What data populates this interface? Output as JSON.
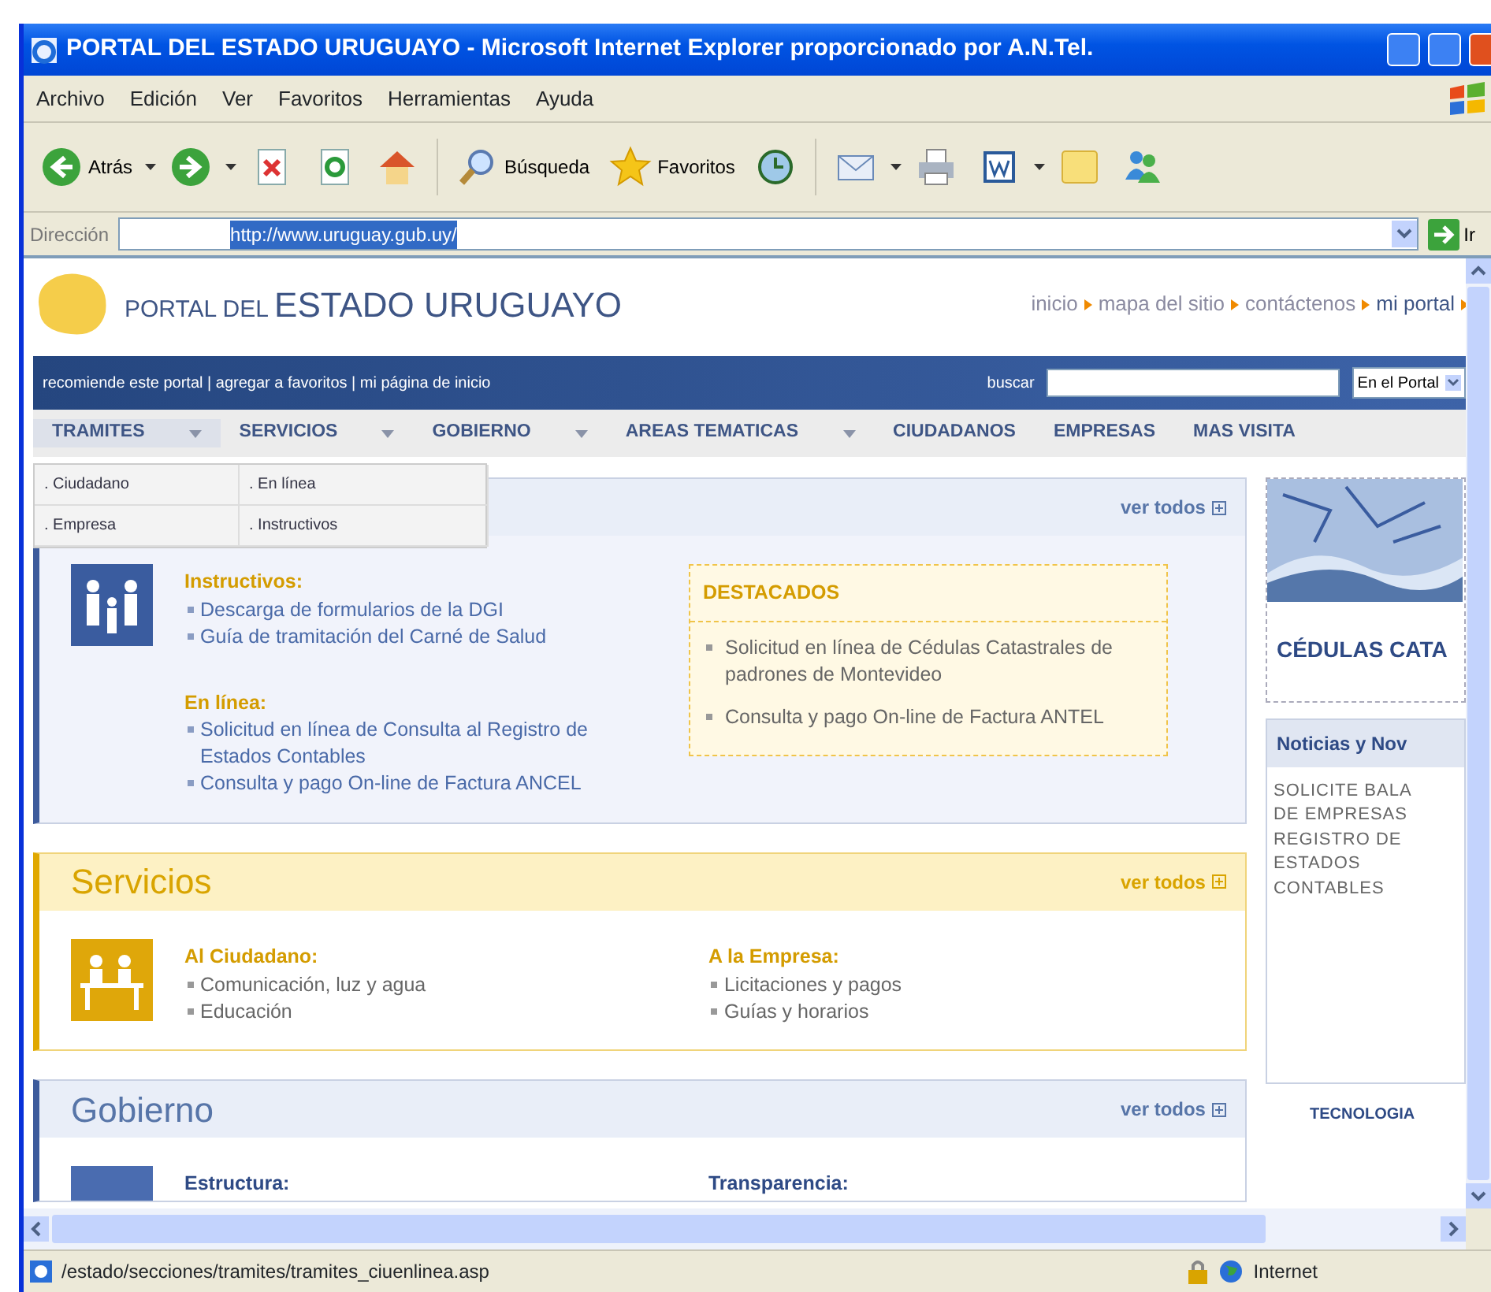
{
  "window": {
    "title": "PORTAL DEL ESTADO URUGUAYO - Microsoft Internet Explorer proporcionado por A.N.Tel."
  },
  "menu": [
    "Archivo",
    "Edición",
    "Ver",
    "Favoritos",
    "Herramientas",
    "Ayuda"
  ],
  "toolbar": [
    {
      "kind": "back",
      "label": "Atrás",
      "dropdown": true
    },
    {
      "kind": "forward",
      "dropdown": true
    },
    {
      "kind": "stop"
    },
    {
      "kind": "refresh"
    },
    {
      "kind": "home"
    },
    {
      "kind": "search",
      "label": "Búsqueda"
    },
    {
      "kind": "favorites",
      "label": "Favoritos"
    },
    {
      "kind": "history"
    },
    {
      "kind": "mail",
      "dropdown": true
    },
    {
      "kind": "print"
    },
    {
      "kind": "word",
      "dropdown": true
    },
    {
      "kind": "folder"
    },
    {
      "kind": "messenger"
    }
  ],
  "address": {
    "label": "Dirección",
    "value": "http://www.uruguay.gub.uy/",
    "selected": true,
    "go": "Ir"
  },
  "page": {
    "logo": {
      "small": "PORTAL DEL",
      "large": "ESTADO URUGUAYO"
    },
    "top_links": [
      "inicio",
      "mapa del sitio",
      "contáctenos",
      "mi portal"
    ],
    "utility_links": "recomiende este portal | agregar a favoritos | mi página de inicio",
    "search": {
      "label": "buscar",
      "scope": "En el Portal"
    },
    "nav": [
      {
        "label": "TRAMITES",
        "dropdown": true,
        "open": true,
        "menu": [
          [
            ". Ciudadano",
            ". Empresa"
          ],
          [
            ". En línea",
            ". Instructivos"
          ]
        ]
      },
      {
        "label": "SERVICIOS",
        "dropdown": true
      },
      {
        "label": "GOBIERNO",
        "dropdown": true
      },
      {
        "label": "AREAS TEMATICAS",
        "dropdown": true
      },
      {
        "label": "CIUDADANOS"
      },
      {
        "label": "EMPRESAS"
      },
      {
        "label": "MAS VISITA"
      }
    ],
    "panels": [
      {
        "more": "ver todos",
        "columns": [
          {
            "heading": "Instructivos:",
            "items": [
              "Descarga de formularios de la DGI",
              "Guía de tramitación del Carné de Salud"
            ]
          },
          {
            "heading": "En línea:",
            "items": [
              "Solicitud en línea de Consulta al Registro de Estados Contables",
              "Consulta y pago On-line de Factura ANCEL"
            ]
          }
        ],
        "featured": {
          "title": "DESTACADOS",
          "items": [
            "Solicitud en línea de Cédulas Catastrales de padrones de Montevideo",
            "Consulta y pago On-line de Factura ANTEL"
          ]
        }
      },
      {
        "title": "Servicios",
        "more": "ver todos",
        "columns": [
          {
            "heading": "Al Ciudadano:",
            "items": [
              "Comunicación, luz y agua",
              "Educación"
            ]
          },
          {
            "heading": "A la Empresa:",
            "items": [
              "Licitaciones y pagos",
              "Guías y horarios"
            ]
          }
        ]
      },
      {
        "title": "Gobierno",
        "more": "ver todos",
        "columns": [
          {
            "heading": "Estructura:"
          },
          {
            "heading": "Transparencia:"
          }
        ]
      }
    ],
    "sidebar": {
      "promo": "CÉDULAS CATA",
      "news_title": "Noticias y Nov",
      "news_lines": [
        "SOLICITE BALA",
        "DE EMPRESAS",
        "REGISTRO DE",
        "ESTADOS",
        "CONTABLES"
      ],
      "tab": "TECNOLOGIA"
    }
  },
  "status_bar": {
    "text": "/estado/secciones/tramites/tramites_ciuenlinea.asp",
    "zone": "Internet"
  }
}
